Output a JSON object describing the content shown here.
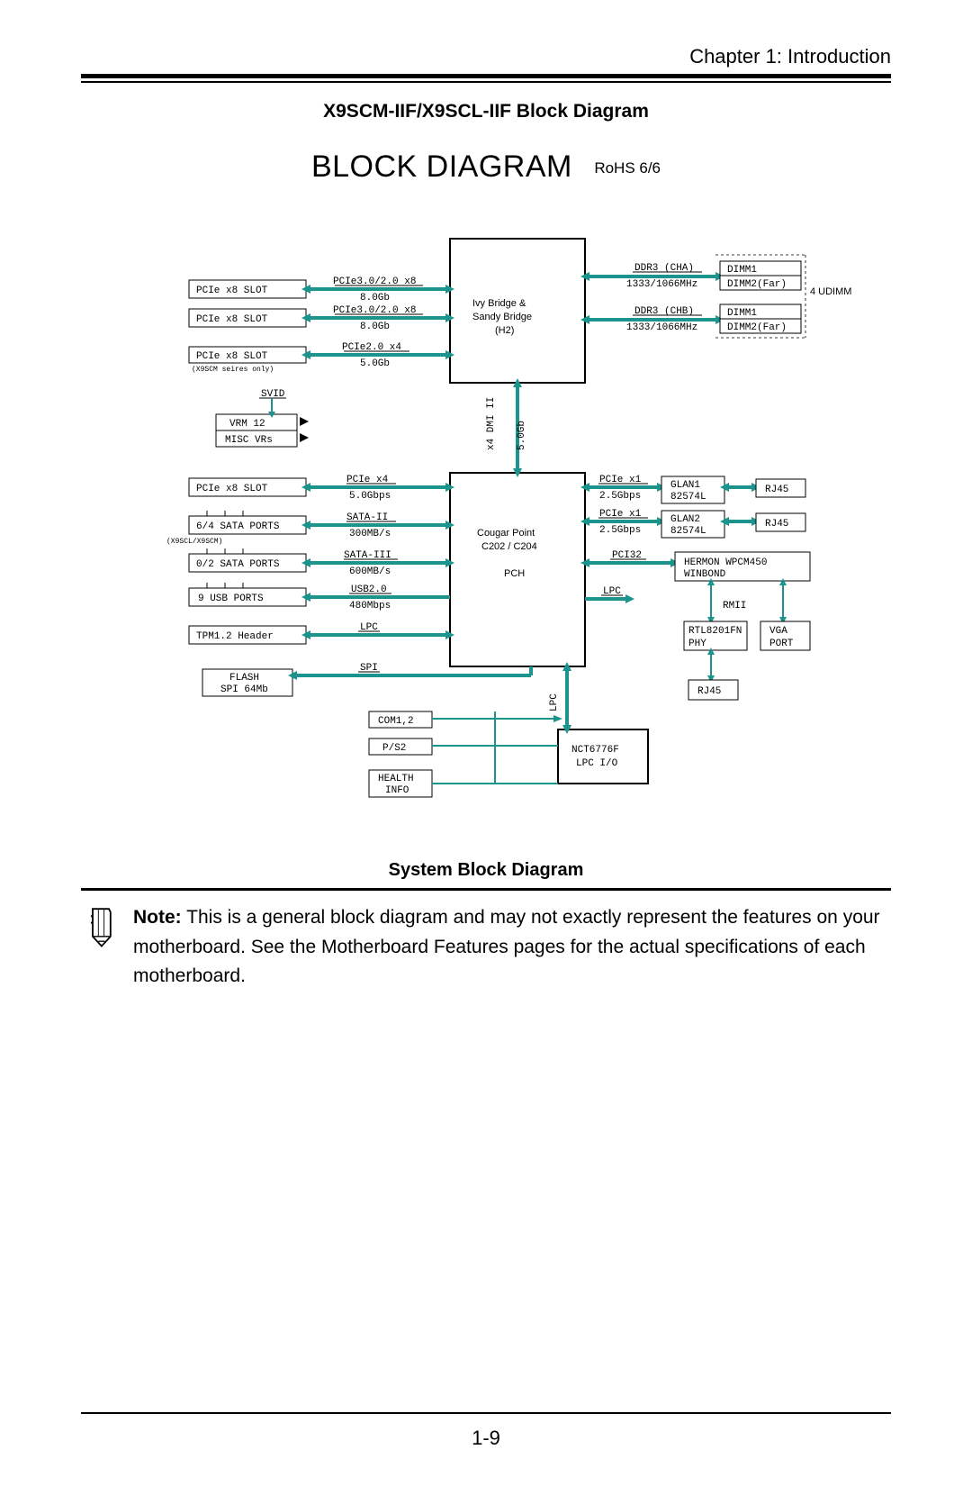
{
  "header": {
    "chapter": "Chapter 1: Introduction"
  },
  "title": "X9SCM-IIF/X9SCL-IIF Block Diagram",
  "heading": "BLOCK DIAGRAM",
  "rohs": "RoHS 6/6",
  "system_title": "System Block Diagram",
  "note": {
    "label": "Note:",
    "body": "This is a general block diagram and may not exactly represent the features on your motherboard. See the Motherboard Features pages for the actual specifications of each motherboard."
  },
  "page_number": "1-9",
  "diagram": {
    "cpu": {
      "l1": "Ivy Bridge &",
      "l2": "Sandy Bridge",
      "l3": "(H2)"
    },
    "pch": {
      "l1": "Cougar Point",
      "l2": "C202 / C204",
      "l3": "PCH"
    },
    "sio": {
      "l1": "NCT6776F",
      "l2": "LPC I/O"
    },
    "left_slots": {
      "pcie_x8_a": "PCIe x8 SLOT",
      "pcie_x8_b": "PCIe x8 SLOT",
      "pcie_x8_c": "PCIe x8 SLOT",
      "pcie_x8_c_sub": "(X9SCM seires only)",
      "vrm": "VRM 12",
      "misc": "MISC VRs",
      "svid": "SVID",
      "pcie_x8_d": "PCIe x8 SLOT",
      "sata64": "6/4 SATA PORTS",
      "sata64_sub": "(X9SCL/X9SCM)",
      "sata02": "0/2 SATA PORTS",
      "usb": "9 USB PORTS",
      "tpm": "TPM1.2 Header",
      "flash_l1": "FLASH",
      "flash_l2": "SPI 64Mb"
    },
    "pch_sub": {
      "com": "COM1,2",
      "ps2": "P/S2",
      "health_l1": "HEALTH",
      "health_l2": "INFO"
    },
    "right": {
      "ddr_cha": "DDR3 (CHA)",
      "ddr_chb": "DDR3 (CHB)",
      "ddr_speed": "1333/1066MHz",
      "dimm1": "DIMM1",
      "dimm2": "DIMM2(Far)",
      "udimm": "4 UDIMM",
      "glan1": "GLAN1\n82574L",
      "glan2": "GLAN2\n82574L",
      "rj45": "RJ45",
      "bmc_l1": "HERMON WPCM450",
      "bmc_l2": "WINBOND",
      "phy_l1": "RTL8201FN",
      "phy_l2": "PHY",
      "vga_l1": "VGA",
      "vga_l2": "PORT"
    },
    "labels": {
      "pcie30_x8": "PCIe3.0/2.0 x8",
      "gb8": "8.0Gb",
      "pcie20_x4": "PCIe2.0 x4",
      "gb5": "5.0Gb",
      "pcie_x4": "PCIe x4",
      "gbps5": "5.0Gbps",
      "sata2": "SATA-II",
      "mb300": "300MB/s",
      "sata3": "SATA-III",
      "mb600": "600MB/s",
      "usb2": "USB2.0",
      "mbps480": "480Mbps",
      "lpc": "LPC",
      "spi": "SPI",
      "dmi": "x4 DMI II",
      "dmi_rate": "5.0Gb",
      "pcie_x1": "PCIe x1",
      "gbps25": "2.5Gbps",
      "pci32": "PCI32",
      "rmii": "RMII"
    }
  }
}
